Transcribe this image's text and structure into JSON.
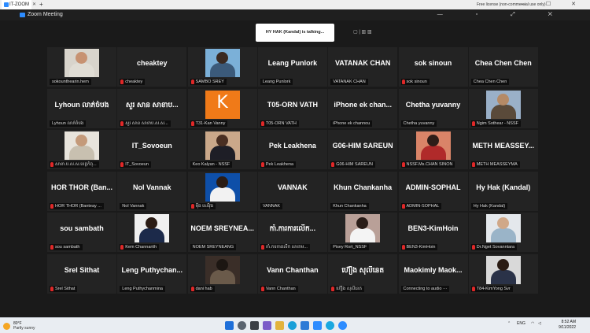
{
  "browser": {
    "tab_title": "IT-ZOOM",
    "tab_close": "✕",
    "new_tab": "+",
    "license_text": "Free license (non-commercial use only)",
    "window_controls": "— ☐ ✕"
  },
  "zoom": {
    "window_title": "Zoom Meeting",
    "window_controls": "— ▫ ⤢ ✕",
    "talking_banner": "HY HAK (Kandal) is talking...",
    "view_control": "▢ | ▥ ▥"
  },
  "tiles": [
    {
      "big": "",
      "label": "sokounthearin.hem",
      "muted": false,
      "photo": "p1"
    },
    {
      "big": "cheaktey",
      "label": "cheaktey",
      "muted": true
    },
    {
      "big": "",
      "label": "SAMBO SREY",
      "muted": true,
      "photo": "p2"
    },
    {
      "big": "Leang Punlork",
      "label": "Leang Punlork",
      "muted": false
    },
    {
      "big": "VATANAK CHAN",
      "label": "VATANAK CHAN",
      "muted": false
    },
    {
      "big": "sok sinoun",
      "label": "sok sinoun",
      "muted": true
    },
    {
      "big": "Chea Chen Chen",
      "label": "Chea Chen Chen",
      "muted": false
    },
    {
      "big": "Lyhoun លាភ់ចំបង",
      "label": "Lyhoun លាភ់ចំបង",
      "muted": false
    },
    {
      "big": "សួរ សាន សាខាប...",
      "label": "សួរ សាន សាខាប.ស.ស...",
      "muted": true
    },
    {
      "big": "",
      "label": "T31-Kan Vanny",
      "muted": true,
      "photo": "p3",
      "letter": "K"
    },
    {
      "big": "T05-ORN VATH",
      "label": "T05-ORN VATH",
      "muted": true
    },
    {
      "big": "iPhone ek chan...",
      "label": "iPhone ek channou",
      "muted": false
    },
    {
      "big": "Chetha yuvanny",
      "label": "Chetha yuvanny",
      "muted": false
    },
    {
      "big": "",
      "label": "Ngim Sothear - NSSF",
      "muted": true,
      "photo": "p4"
    },
    {
      "big": "",
      "label": "សាខា.ប.ស.ស.ខេត្តកំពុ...",
      "muted": true,
      "photo": "p5"
    },
    {
      "big": "IT_Sovoeun",
      "label": "IT_Sovoeun",
      "muted": true
    },
    {
      "big": "",
      "label": "Keo Kalyan - NSSF",
      "muted": false,
      "photo": "p6"
    },
    {
      "big": "Pek Leakhena",
      "label": "Pek Leakhena",
      "muted": true
    },
    {
      "big": "G06-HIM SAREUN",
      "label": "G06-HIM SAREUN",
      "muted": true
    },
    {
      "big": "",
      "label": "NSSF.Ms.CHAN SINON",
      "muted": true,
      "photo": "p7"
    },
    {
      "big": "METH MEASSEY...",
      "label": "METH MEASSEYMA",
      "muted": true
    },
    {
      "big": "HOR THOR (Ban...",
      "label": "HOR THOR (Banteay ...",
      "muted": true
    },
    {
      "big": "Nol Vannak",
      "label": "Nol Vannak",
      "muted": false
    },
    {
      "big": "",
      "label": "ម៉ឹង សេរីវុធ",
      "muted": true,
      "photo": "p8"
    },
    {
      "big": "VANNAK",
      "label": "VANNAK",
      "muted": false
    },
    {
      "big": "Khun Chankanha",
      "label": "Khun Chankanha",
      "muted": false
    },
    {
      "big": "ADMIN-SOPHAL",
      "label": "ADMIN-SOPHAL",
      "muted": true
    },
    {
      "big": "Hy Hak (Kandal)",
      "label": "Hy Hak (Kandal)",
      "muted": false
    },
    {
      "big": "sou sambath",
      "label": "sou sambath",
      "muted": true
    },
    {
      "big": "",
      "label": "Kem Channarith",
      "muted": true,
      "photo": "p9"
    },
    {
      "big": "NOEM SREYNEA...",
      "label": "NOEM SREYNEANG",
      "muted": false
    },
    {
      "big": "កាំ.ការការលើក...",
      "label": "កាំ.ការការលើក សាខាម...",
      "muted": true
    },
    {
      "big": "",
      "label": "Pisey Rort_NSSF",
      "muted": false,
      "photo": "p10"
    },
    {
      "big": "BEN3-KimHoin",
      "label": "BEN3-KimHoin",
      "muted": true
    },
    {
      "big": "",
      "label": "Dr.Nget Sovanntara",
      "muted": true,
      "photo": "p11"
    },
    {
      "big": "Srel Sithat",
      "label": "Srel Sithat",
      "muted": true
    },
    {
      "big": "Leng Puthychan...",
      "label": "Leng Puthychanmina",
      "muted": false
    },
    {
      "big": "",
      "label": "dani hab",
      "muted": true,
      "photo": "p12"
    },
    {
      "big": "Vann Chanthan",
      "label": "Vann Chanthan",
      "muted": true
    },
    {
      "big": "ហ៊ឿង សុលីនេត",
      "label": "ហ៊ឿង សុលីនេត",
      "muted": true
    },
    {
      "big": "Maokimly Maok...",
      "label": "Connecting to audio ···",
      "muted": false
    },
    {
      "big": "",
      "label": "T84-KimYong Svr",
      "muted": true,
      "photo": "p13"
    }
  ],
  "taskbar": {
    "temperature": "80°F",
    "condition": "Partly sunny",
    "language": "ENG",
    "time": "8:52 AM",
    "date": "9/11/2022"
  }
}
